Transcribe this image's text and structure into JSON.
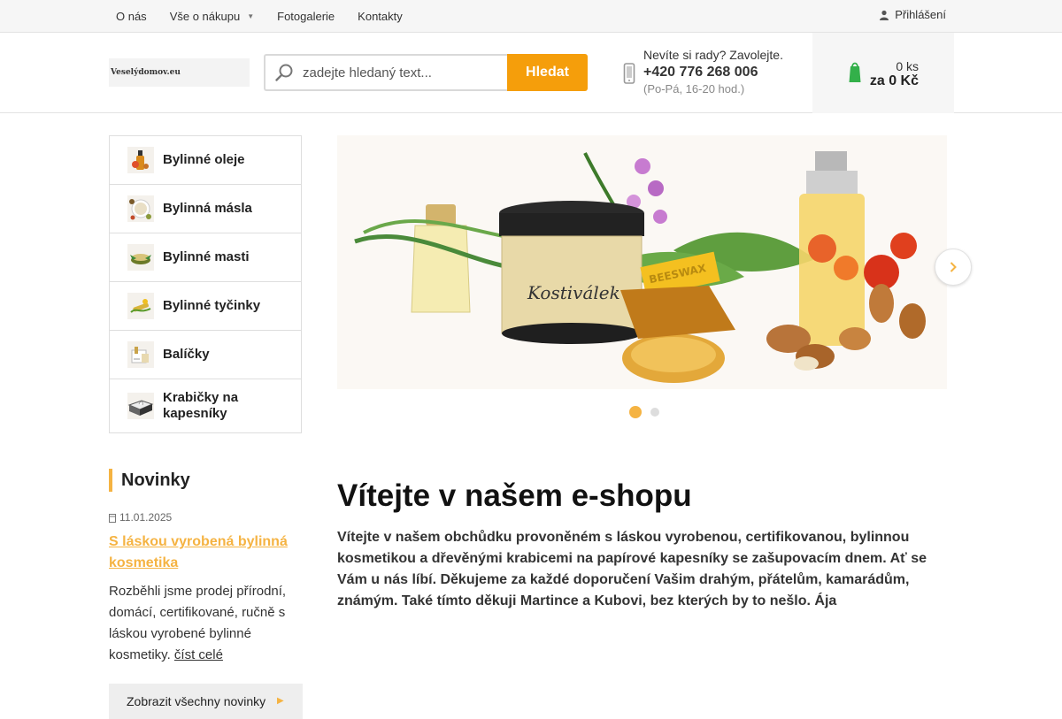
{
  "topbar": {
    "nav": [
      {
        "label": "O nás"
      },
      {
        "label": "Vše o nákupu",
        "has_dropdown": true
      },
      {
        "label": "Fotogalerie"
      },
      {
        "label": "Kontakty"
      }
    ],
    "login_label": "Přihlášení"
  },
  "header": {
    "logo_text": "Veselýdomov.eu",
    "search": {
      "placeholder": "zadejte hledaný text...",
      "button_label": "Hledat"
    },
    "help": {
      "question": "Nevíte si rady? Zavolejte.",
      "phone": "+420 776 268 006",
      "hours": "(Po-Pá, 16-20 hod.)"
    },
    "cart": {
      "count": "0 ks",
      "total": "za 0 Kč"
    }
  },
  "categories": [
    {
      "label": "Bylinné oleje",
      "icon": "oil-bottle-icon"
    },
    {
      "label": "Bylinná másla",
      "icon": "butter-jar-icon"
    },
    {
      "label": "Bylinné masti",
      "icon": "ointment-icon"
    },
    {
      "label": "Bylinné tyčinky",
      "icon": "lip-balm-icon"
    },
    {
      "label": "Balíčky",
      "icon": "gift-pack-icon"
    },
    {
      "label": "Krabičky na kapesníky",
      "icon": "tissue-box-icon"
    }
  ],
  "news": {
    "heading": "Novinky",
    "date": "11.01.2025",
    "title": "S láskou vyrobená bylinná kosmetika",
    "text": "Rozběhli jsme prodej přírodní, domácí, certifikované, ručně s láskou vyrobené bylinné kosmetiky.",
    "read_more": "číst celé",
    "all_label": "Zobrazit všechny novinky"
  },
  "banner": {
    "jar_label": "Kostiválek",
    "beeswax_label": "BEESWAX",
    "slides": 2,
    "active_slide": 1
  },
  "welcome": {
    "heading": "Vítejte v našem e-shopu",
    "text": "Vítejte v našem obchůdku provoněném s láskou vyrobenou, certifikovanou, bylinnou kosmetikou a dřevěnými krabicemi na papírové kapesníky se zašupovacím dnem. Ať se Vám u nás líbí. Děkujeme za každé doporučení Vašim drahým, přátelům, kamarádům, známým. Také tímto děkuji Martince a Kubovi, bez kterých by to nešlo. Ája"
  },
  "colors": {
    "accent": "#f5b342",
    "button": "#f59e0b"
  }
}
